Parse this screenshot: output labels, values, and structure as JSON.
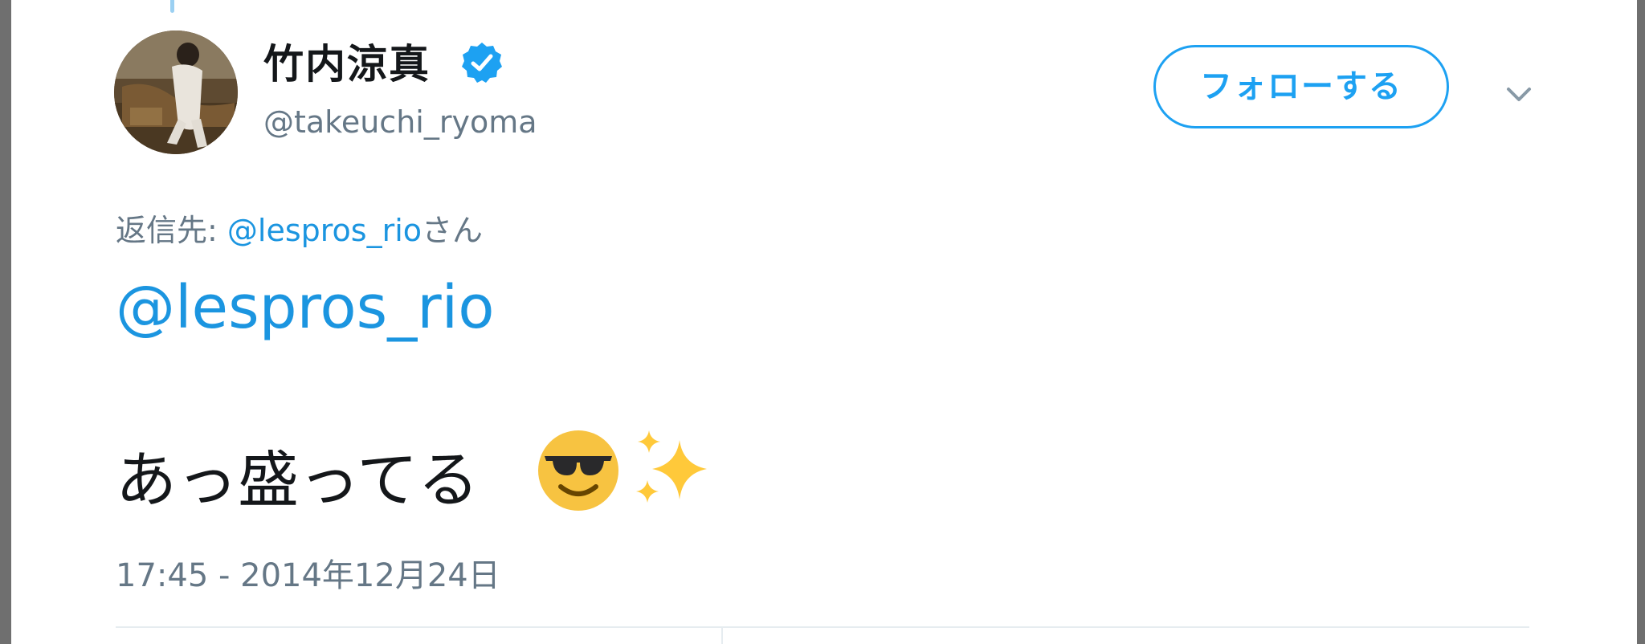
{
  "tweet": {
    "display_name": "竹内涼真",
    "screen_name": "@takeuchi_ryoma",
    "verified": true,
    "follow_button_label": "フォローする",
    "reply_to": {
      "prefix": "返信先: ",
      "mention": "@lespros_rio",
      "suffix": "さん"
    },
    "mention": "@lespros_rio",
    "text": "あっ盛ってる",
    "emojis": [
      "smiling-face-with-sunglasses",
      "sparkles"
    ],
    "timestamp": "17:45 - 2014年12月24日"
  },
  "colors": {
    "link": "#1b95e0",
    "accent": "#1da1f2",
    "secondary_text": "#657786",
    "primary_text": "#14171a"
  },
  "icons": {
    "verified": "verified-badge-icon",
    "more": "chevron-down-icon"
  }
}
